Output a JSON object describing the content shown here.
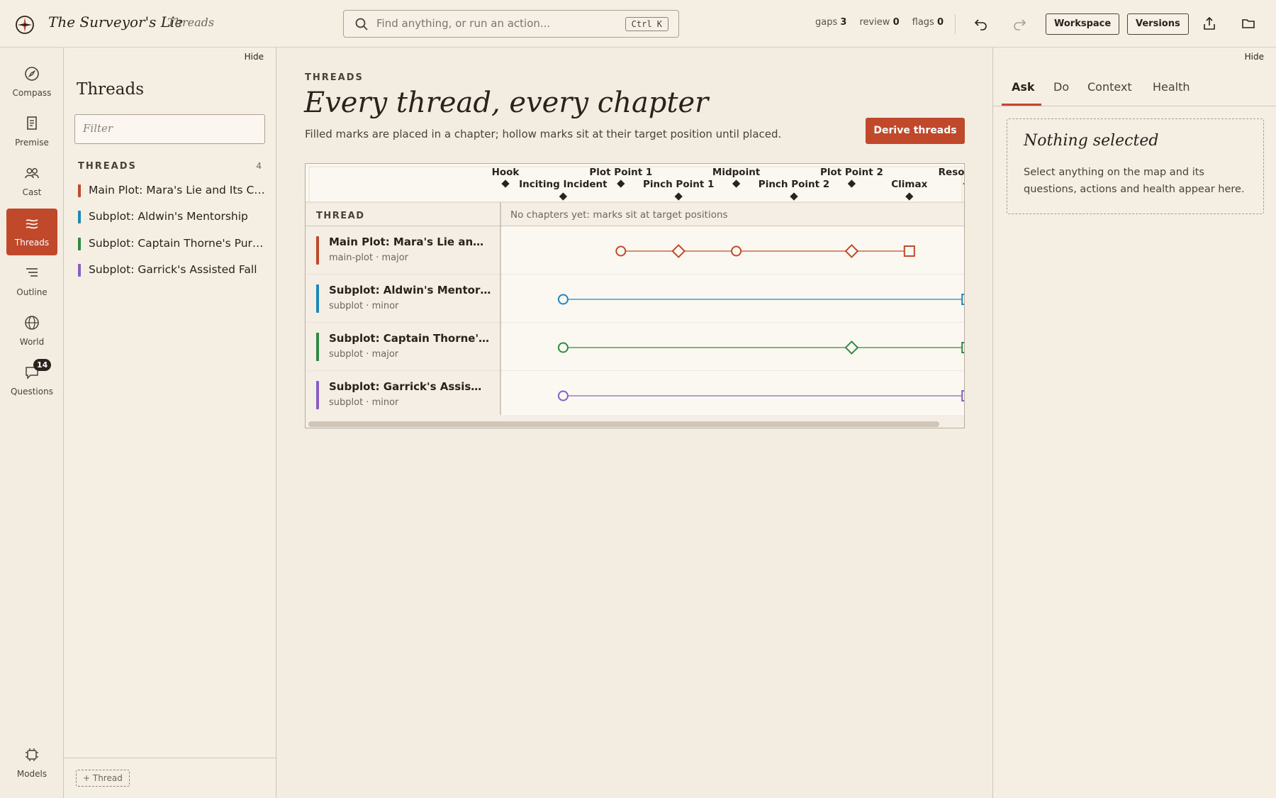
{
  "app": {
    "title": "The Surveyor's Lie",
    "breadcrumb": "Threads"
  },
  "search": {
    "placeholder": "Find anything, or run an action...",
    "shortcut": "Ctrl K"
  },
  "status": {
    "gaps_label": "gaps",
    "gaps": "3",
    "review_label": "review",
    "review": "0",
    "flags_label": "flags",
    "flags": "0"
  },
  "toolbar": {
    "workspace": "Workspace",
    "versions": "Versions",
    "undo_icon": "undo-icon",
    "redo_icon": "redo-icon",
    "export_icon": "share-icon",
    "folder_icon": "folder-icon"
  },
  "rail": {
    "items": [
      {
        "label": "Compass",
        "icon": "compass-icon"
      },
      {
        "label": "Premise",
        "icon": "document-icon"
      },
      {
        "label": "Cast",
        "icon": "people-icon"
      },
      {
        "label": "Threads",
        "icon": "threads-icon",
        "active": true
      },
      {
        "label": "Outline",
        "icon": "outline-icon"
      },
      {
        "label": "World",
        "icon": "globe-icon"
      },
      {
        "label": "Questions",
        "icon": "chat-icon",
        "badge": "14"
      }
    ],
    "bottom": {
      "label": "Models",
      "icon": "chip-icon"
    }
  },
  "threads_panel": {
    "hide": "Hide",
    "title": "Threads",
    "filter_placeholder": "Filter",
    "section_label": "THREADS",
    "count": "4",
    "items": [
      {
        "name": "Main Plot: Mara's Lie and Its Consequences",
        "color": "#c0492b"
      },
      {
        "name": "Subplot: Aldwin's Mentorship",
        "color": "#1f86b8"
      },
      {
        "name": "Subplot: Captain Thorne's Pursuit",
        "color": "#2f8a3e"
      },
      {
        "name": "Subplot: Garrick's Assisted Fall",
        "color": "#8a5cc4"
      }
    ],
    "add_button": "+ Thread"
  },
  "main": {
    "eyebrow": "THREADS",
    "heading": "Every thread, every chapter",
    "subtitle": "Filled marks are placed in a chapter; hollow marks sit at their target position until placed.",
    "derive_button": "Derive threads",
    "grid": {
      "column_header": "THREAD",
      "empty_message": "No chapters yet: marks sit at target positions",
      "beats_top": [
        "Hook",
        "Plot Point 1",
        "Midpoint",
        "Plot Point 2",
        "Resolution"
      ],
      "beats_bottom": [
        "Inciting Incident",
        "Pinch Point 1",
        "Pinch Point 2",
        "Climax"
      ],
      "rows": [
        {
          "name": "Main Plot: Mara's Lie and Its Consequences",
          "meta": "main-plot · major",
          "color": "#c0492b",
          "marks": [
            {
              "shape": "circle",
              "at": "Plot Point 1"
            },
            {
              "shape": "diamond",
              "at": "Pinch Point 1"
            },
            {
              "shape": "circle",
              "at": "Midpoint"
            },
            {
              "shape": "diamond",
              "at": "Plot Point 2"
            },
            {
              "shape": "square",
              "at": "Climax"
            }
          ]
        },
        {
          "name": "Subplot: Aldwin's Mentorship",
          "meta": "subplot · minor",
          "color": "#1f86b8",
          "marks": [
            {
              "shape": "circle",
              "at": "Inciting Incident"
            },
            {
              "shape": "square",
              "at": "Resolution"
            }
          ]
        },
        {
          "name": "Subplot: Captain Thorne's Pursuit",
          "meta": "subplot · major",
          "color": "#2f8a3e",
          "marks": [
            {
              "shape": "circle",
              "at": "Inciting Incident"
            },
            {
              "shape": "diamond",
              "at": "Plot Point 2"
            },
            {
              "shape": "square",
              "at": "Resolution"
            }
          ]
        },
        {
          "name": "Subplot: Garrick's Assisted Fall",
          "meta": "subplot · minor",
          "color": "#8a5cc4",
          "marks": [
            {
              "shape": "circle",
              "at": "Inciting Incident"
            },
            {
              "shape": "square",
              "at": "Resolution"
            }
          ]
        }
      ]
    }
  },
  "inspector": {
    "hide": "Hide",
    "tabs": [
      "Ask",
      "Do",
      "Context",
      "Health"
    ],
    "active_tab": "Ask",
    "empty_title": "Nothing selected",
    "empty_text": "Select anything on the map and its questions, actions and health appear here."
  },
  "colors": {
    "accent": "#c0492b",
    "background": "#f3ece0"
  }
}
